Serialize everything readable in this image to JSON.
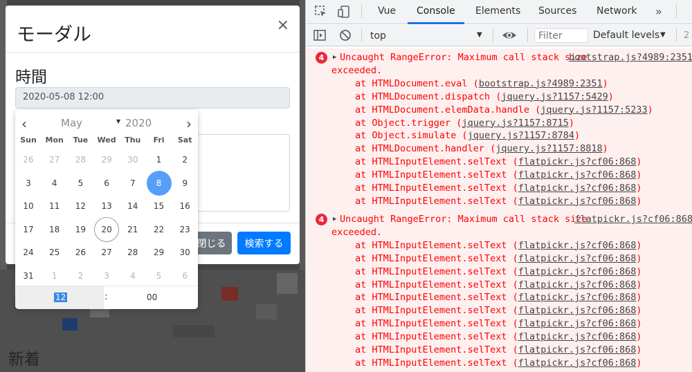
{
  "page": {
    "heading": "新着"
  },
  "modal": {
    "title": "モーダル",
    "close_symbol": "×",
    "field_label": "時間",
    "datetime_value": "2020-05-08 12:00",
    "close_button": "閉じる",
    "search_button": "検索する",
    "accent_color": "#007bff"
  },
  "datepicker": {
    "month": "May",
    "year": "2020",
    "prev_icon": "chevron-left-icon",
    "next_icon": "chevron-right-icon",
    "weekdays": [
      "Sun",
      "Mon",
      "Tue",
      "Wed",
      "Thu",
      "Fri",
      "Sat"
    ],
    "weeks": [
      [
        "26",
        "27",
        "28",
        "29",
        "30",
        "1",
        "2"
      ],
      [
        "3",
        "4",
        "5",
        "6",
        "7",
        "8",
        "9"
      ],
      [
        "10",
        "11",
        "12",
        "13",
        "14",
        "15",
        "16"
      ],
      [
        "17",
        "18",
        "19",
        "20",
        "21",
        "22",
        "23"
      ],
      [
        "24",
        "25",
        "26",
        "27",
        "28",
        "29",
        "30"
      ],
      [
        "31",
        "1",
        "2",
        "3",
        "4",
        "5",
        "6"
      ]
    ],
    "selected_day": "8",
    "today_day": "20",
    "hour": "12",
    "time_separator": ":",
    "minute": "00",
    "selected_color": "#569ff7"
  },
  "devtools": {
    "tabs": [
      "Vue",
      "Console",
      "Elements",
      "Sources",
      "Network"
    ],
    "active_tab": "Console",
    "more_symbol": "»",
    "context": "top",
    "filter_placeholder": "Filter",
    "levels": "Default levels",
    "toolbar_trail": "2",
    "errors": [
      {
        "count": "4",
        "message": "Uncaught RangeError: Maximum call stack size",
        "message_cont": "exceeded.",
        "source": "bootstrap.js?4989:2351",
        "stack": [
          {
            "fn": "at HTMLDocument.eval (",
            "loc": "bootstrap.js?4989:2351",
            "end": ")"
          },
          {
            "fn": "at HTMLDocument.dispatch (",
            "loc": "jquery.js?1157:5429",
            "end": ")"
          },
          {
            "fn": "at HTMLDocument.elemData.handle (",
            "loc": "jquery.js?1157:5233",
            "end": ")"
          },
          {
            "fn": "at Object.trigger (",
            "loc": "jquery.js?1157:8715",
            "end": ")"
          },
          {
            "fn": "at Object.simulate (",
            "loc": "jquery.js?1157:8784",
            "end": ")"
          },
          {
            "fn": "at HTMLDocument.handler (",
            "loc": "jquery.js?1157:8818",
            "end": ")"
          },
          {
            "fn": "at HTMLInputElement.selText (",
            "loc": "flatpickr.js?cf06:868",
            "end": ")"
          },
          {
            "fn": "at HTMLInputElement.selText (",
            "loc": "flatpickr.js?cf06:868",
            "end": ")"
          },
          {
            "fn": "at HTMLInputElement.selText (",
            "loc": "flatpickr.js?cf06:868",
            "end": ")"
          },
          {
            "fn": "at HTMLInputElement.selText (",
            "loc": "flatpickr.js?cf06:868",
            "end": ")"
          }
        ]
      },
      {
        "count": "4",
        "message": "Uncaught RangeError: Maximum call stack size",
        "message_cont": "exceeded.",
        "source": "flatpickr.js?cf06:868",
        "stack": [
          {
            "fn": "at HTMLInputElement.selText (",
            "loc": "flatpickr.js?cf06:868",
            "end": ")"
          },
          {
            "fn": "at HTMLInputElement.selText (",
            "loc": "flatpickr.js?cf06:868",
            "end": ")"
          },
          {
            "fn": "at HTMLInputElement.selText (",
            "loc": "flatpickr.js?cf06:868",
            "end": ")"
          },
          {
            "fn": "at HTMLInputElement.selText (",
            "loc": "flatpickr.js?cf06:868",
            "end": ")"
          },
          {
            "fn": "at HTMLInputElement.selText (",
            "loc": "flatpickr.js?cf06:868",
            "end": ")"
          },
          {
            "fn": "at HTMLInputElement.selText (",
            "loc": "flatpickr.js?cf06:868",
            "end": ")"
          },
          {
            "fn": "at HTMLInputElement.selText (",
            "loc": "flatpickr.js?cf06:868",
            "end": ")"
          },
          {
            "fn": "at HTMLInputElement.selText (",
            "loc": "flatpickr.js?cf06:868",
            "end": ")"
          },
          {
            "fn": "at HTMLInputElement.selText (",
            "loc": "flatpickr.js?cf06:868",
            "end": ")"
          },
          {
            "fn": "at HTMLInputElement.selText (",
            "loc": "flatpickr.js?cf06:868",
            "end": ")"
          }
        ]
      }
    ]
  }
}
